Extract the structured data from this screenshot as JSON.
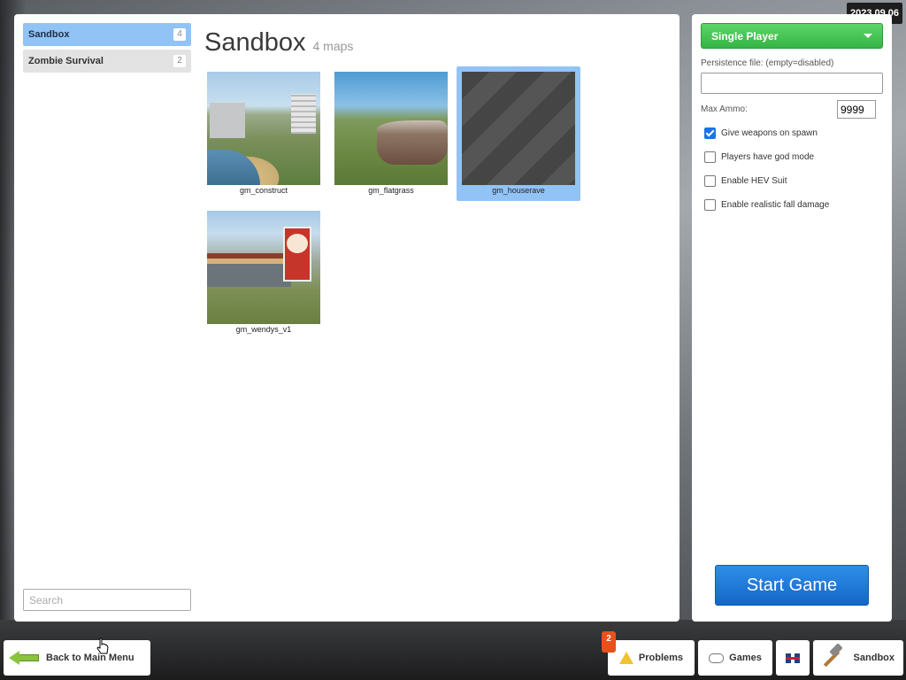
{
  "date_badge": "2023.09.06",
  "categories": [
    {
      "label": "Sandbox",
      "count": "4",
      "selected": true
    },
    {
      "label": "Zombie Survival",
      "count": "2",
      "selected": false
    }
  ],
  "search": {
    "placeholder": "Search"
  },
  "heading": {
    "title": "Sandbox",
    "subtitle": "4 maps"
  },
  "maps": [
    {
      "name": "gm_construct",
      "selected": false
    },
    {
      "name": "gm_flatgrass",
      "selected": false
    },
    {
      "name": "gm_houserave",
      "selected": true
    },
    {
      "name": "gm_wendys_v1",
      "selected": false
    }
  ],
  "settings": {
    "mode": "Single Player",
    "persistence_label": "Persistence file: (empty=disabled)",
    "persistence_value": "",
    "max_ammo_label": "Max Ammo:",
    "max_ammo_value": "9999",
    "options": [
      {
        "label": "Give weapons on spawn",
        "checked": true
      },
      {
        "label": "Players have god mode",
        "checked": false
      },
      {
        "label": "Enable HEV Suit",
        "checked": false
      },
      {
        "label": "Enable realistic fall damage",
        "checked": false
      }
    ],
    "start_label": "Start Game"
  },
  "bottom_bar": {
    "back_label": "Back to Main Menu",
    "problems_label": "Problems",
    "problems_count": "2",
    "games_label": "Games",
    "gamemode_label": "Sandbox"
  },
  "colors": {
    "accent_blue": "#92c3f6",
    "start_blue": "#1467c7",
    "mode_green": "#36b445",
    "problem_orange": "#e8521a"
  }
}
